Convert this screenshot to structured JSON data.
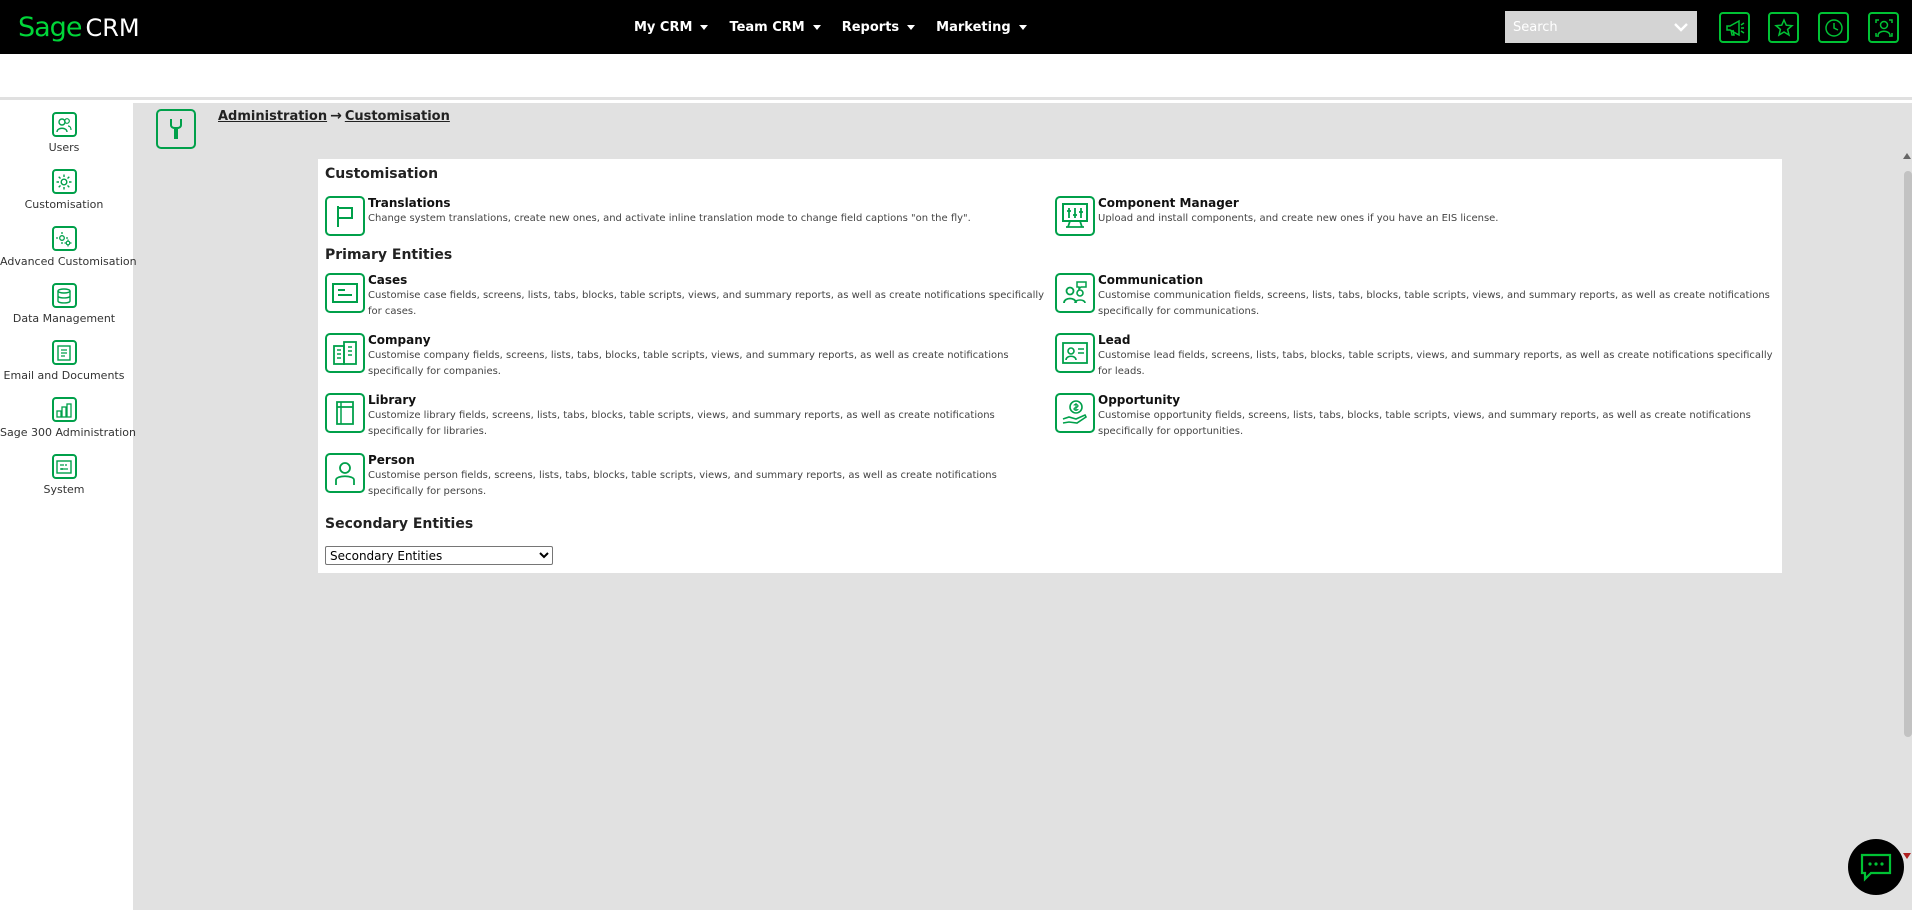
{
  "app": {
    "logo_sage": "Sage",
    "logo_crm": "CRM"
  },
  "nav": {
    "items": [
      {
        "label": "My CRM"
      },
      {
        "label": "Team CRM"
      },
      {
        "label": "Reports"
      },
      {
        "label": "Marketing"
      }
    ]
  },
  "search": {
    "placeholder": "Search"
  },
  "top_icons": [
    "megaphone-icon",
    "star-icon",
    "clock-icon",
    "user-card-icon"
  ],
  "sidebar": {
    "items": [
      {
        "label": "Users",
        "icon": "users-icon"
      },
      {
        "label": "Customisation",
        "icon": "gear-icon"
      },
      {
        "label": "Advanced Customisation",
        "icon": "advanced-gear-icon"
      },
      {
        "label": "Data Management",
        "icon": "database-icon"
      },
      {
        "label": "Email and Documents",
        "icon": "document-icon"
      },
      {
        "label": "Sage 300 Administration",
        "icon": "chart-building-icon"
      },
      {
        "label": "System",
        "icon": "system-icon"
      }
    ]
  },
  "breadcrumb": {
    "parent": "Administration",
    "arrow": "→",
    "current": "Customisation"
  },
  "panel": {
    "customisation_title": "Customisation",
    "primary_title": "Primary Entities",
    "secondary_title": "Secondary Entities",
    "secondary_select_value": "Secondary Entities",
    "customisation_items": [
      {
        "title": "Translations",
        "desc": "Change system translations, create new ones, and activate inline translation mode to change field captions \"on the fly\".",
        "icon": "flag-icon"
      },
      {
        "title": "Component Manager",
        "desc": "Upload and install components, and create new ones if you have an EIS license.",
        "icon": "sliders-monitor-icon"
      }
    ],
    "primary_items": [
      {
        "title": "Cases",
        "desc": "Customise case fields, screens, lists, tabs, blocks, table scripts, views, and summary reports, as well as create notifications specifically for cases.",
        "icon": "case-icon"
      },
      {
        "title": "Communication",
        "desc": "Customise communication fields, screens, lists, tabs, blocks, table scripts, views, and summary reports, as well as create notifications specifically for communications.",
        "icon": "communication-icon"
      },
      {
        "title": "Company",
        "desc": "Customise company fields, screens, lists, tabs, blocks, table scripts, views, and summary reports, as well as create notifications specifically for companies.",
        "icon": "company-icon"
      },
      {
        "title": "Lead",
        "desc": "Customise lead fields, screens, lists, tabs, blocks, table scripts, views, and summary reports, as well as create notifications specifically for leads.",
        "icon": "lead-icon"
      },
      {
        "title": "Library",
        "desc": "Customize library fields, screens, lists, tabs, blocks, table scripts, views, and summary reports, as well as create notifications specifically for libraries.",
        "icon": "library-icon"
      },
      {
        "title": "Opportunity",
        "desc": "Customise opportunity fields, screens, lists, tabs, blocks, table scripts, views, and summary reports, as well as create notifications specifically for opportunities.",
        "icon": "opportunity-icon"
      },
      {
        "title": "Person",
        "desc": "Customise person fields, screens, lists, tabs, blocks, table scripts, views, and summary reports, as well as create notifications specifically for persons.",
        "icon": "person-icon"
      }
    ]
  },
  "colors": {
    "brand_green": "#00d639",
    "icon_green": "#00a04a",
    "topbar_bg": "#000000",
    "page_bg": "#e1e1e1"
  }
}
